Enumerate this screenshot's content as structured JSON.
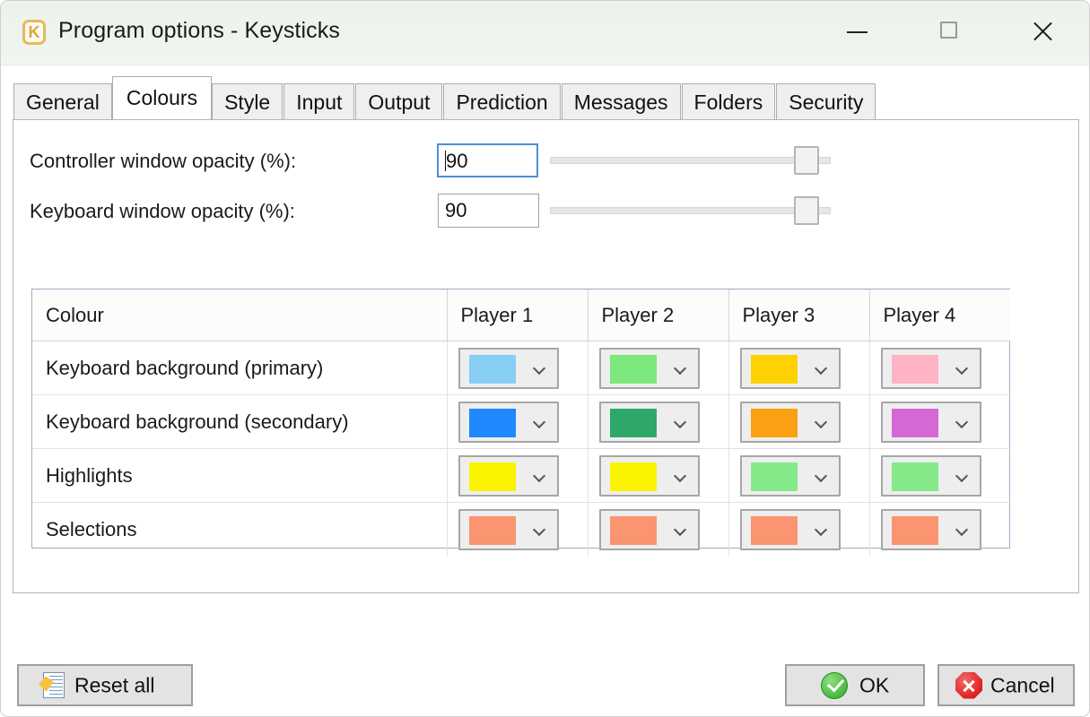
{
  "window": {
    "title": "Program options - Keysticks",
    "app_icon": "keysticks-k-icon",
    "controls": {
      "minimize": "minimize-icon",
      "maximize": "maximize-icon",
      "close": "close-icon"
    }
  },
  "tabs": [
    {
      "label": "General",
      "active": false
    },
    {
      "label": "Colours",
      "active": true
    },
    {
      "label": "Style",
      "active": false
    },
    {
      "label": "Input",
      "active": false
    },
    {
      "label": "Output",
      "active": false
    },
    {
      "label": "Prediction",
      "active": false
    },
    {
      "label": "Messages",
      "active": false
    },
    {
      "label": "Folders",
      "active": false
    },
    {
      "label": "Security",
      "active": false
    }
  ],
  "opacity_fields": [
    {
      "label": "Controller window opacity (%):",
      "value": "90",
      "focused": true,
      "slider_percent": 90
    },
    {
      "label": "Keyboard window opacity (%):",
      "value": "90",
      "focused": false,
      "slider_percent": 90
    }
  ],
  "colour_grid": {
    "headers": [
      "Colour",
      "Player 1",
      "Player 2",
      "Player 3",
      "Player 4"
    ],
    "rows": [
      {
        "label": "Keyboard background (primary)",
        "colours": [
          "#87CEF5",
          "#7DE87D",
          "#FFD100",
          "#FFB3C4"
        ]
      },
      {
        "label": "Keyboard background (secondary)",
        "colours": [
          "#1E88FC",
          "#2EA86A",
          "#FBA012",
          "#D468D4"
        ]
      },
      {
        "label": "Highlights",
        "colours": [
          "#FAF400",
          "#FAF400",
          "#85E98A",
          "#85E98A"
        ]
      },
      {
        "label": "Selections",
        "colours": [
          "#FB9470",
          "#FB9470",
          "#FB9470",
          "#FB9470"
        ]
      }
    ]
  },
  "buttons": {
    "reset": "Reset all",
    "ok": "OK",
    "cancel": "Cancel"
  }
}
